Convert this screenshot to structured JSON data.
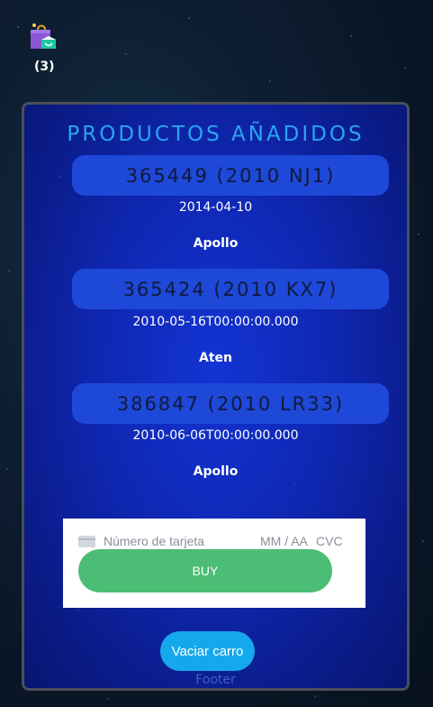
{
  "cart": {
    "icon": "shopping-bag-icon",
    "count": "(3)"
  },
  "panel": {
    "title": "PRODUCTOS AÑADIDOS",
    "products": [
      {
        "name": "365449 (2010 NJ1)",
        "date": "2014-04-10",
        "mission": "Apollo"
      },
      {
        "name": "365424 (2010 KX7)",
        "date": "2010-05-16T00:00:00.000",
        "mission": "Aten"
      },
      {
        "name": "386847 (2010 LR33)",
        "date": "2010-06-06T00:00:00.000",
        "mission": "Apollo"
      }
    ]
  },
  "payment": {
    "card_icon": "credit-card-icon",
    "card_number_placeholder": "Número de tarjeta",
    "expiry_placeholder": "MM / AA",
    "cvc_placeholder": "CVC",
    "buy_label": "BUY"
  },
  "empty_cart_label": "Vaciar carro",
  "footer": "Footer",
  "colors": {
    "panel_bg": "#0f26b0",
    "title": "#2aa4f0",
    "product_pill": "#1e48d8",
    "buy_button": "#4cbd74",
    "empty_button": "#16a8ec"
  }
}
